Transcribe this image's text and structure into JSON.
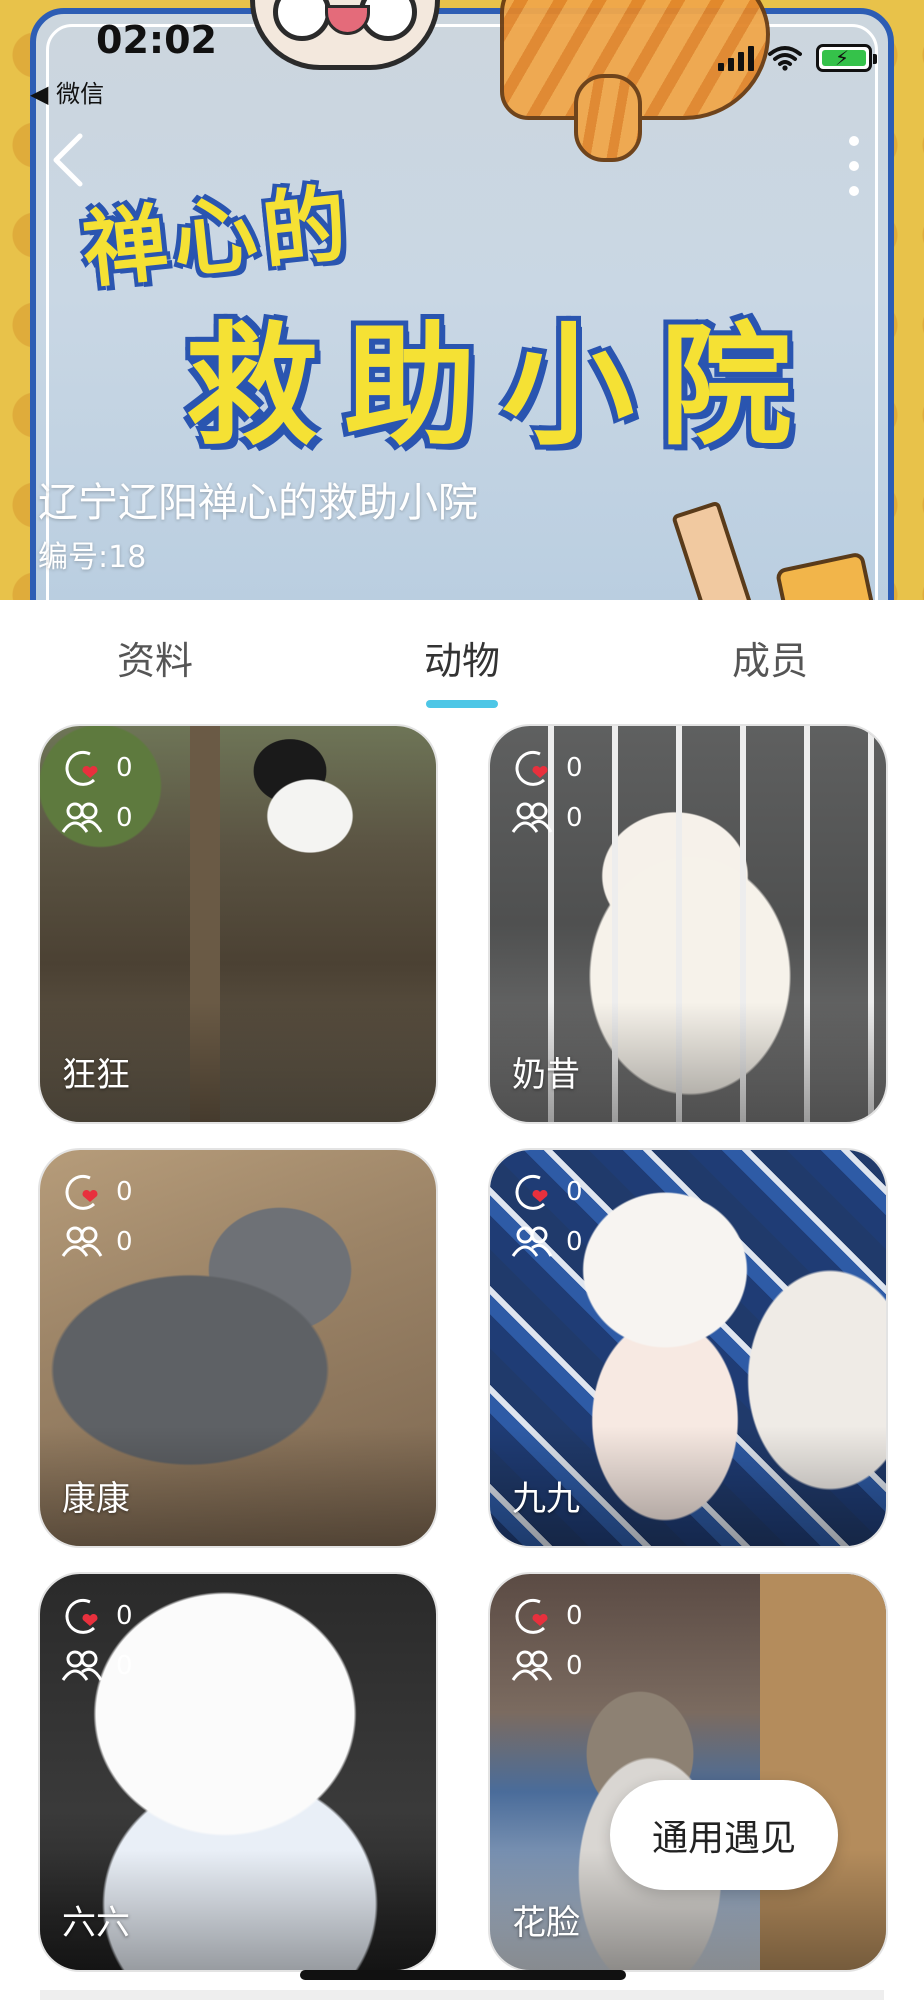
{
  "status_bar": {
    "time": "02:02",
    "back_app": "微信"
  },
  "hero": {
    "banner_small": "禅心的",
    "banner_big": "救助小院",
    "name": "辽宁辽阳禅心的救助小院",
    "code": "编号:18"
  },
  "tabs": [
    {
      "label": "资料"
    },
    {
      "label": "动物",
      "active": true
    },
    {
      "label": "成员"
    }
  ],
  "animals": [
    {
      "name": "狂狂",
      "likes": "0",
      "followers": "0"
    },
    {
      "name": "奶昔",
      "likes": "0",
      "followers": "0"
    },
    {
      "name": "康康",
      "likes": "0",
      "followers": "0"
    },
    {
      "name": "九九",
      "likes": "0",
      "followers": "0"
    },
    {
      "name": "六六",
      "likes": "0",
      "followers": "0"
    },
    {
      "name": "花脸",
      "likes": "0",
      "followers": "0"
    }
  ],
  "float_button": {
    "label": "通用遇见"
  },
  "colors": {
    "accent": "#4dc6e6",
    "banner_yellow": "#f5e134",
    "banner_blue": "#2a55b0",
    "like_heart": "#e8303d"
  },
  "icons": [
    "back-arrow-icon",
    "more-vertical-icon",
    "signal-icon",
    "wifi-icon",
    "battery-charging-icon",
    "like-heart-icon",
    "people-icon"
  ]
}
